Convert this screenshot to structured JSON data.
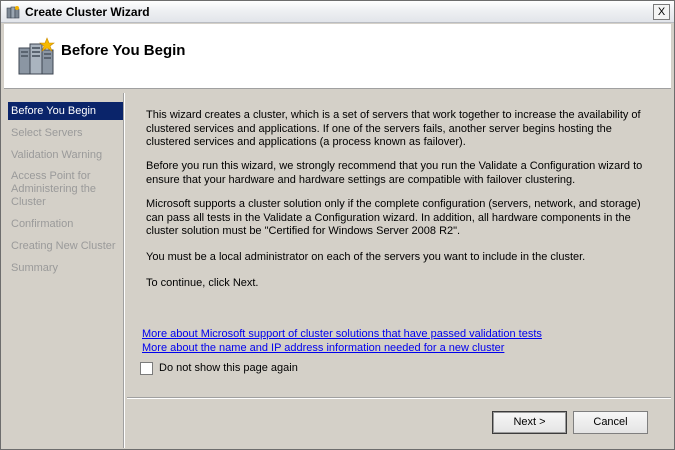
{
  "window": {
    "title": "Create Cluster Wizard",
    "close_glyph": "X"
  },
  "header": {
    "title": "Before You Begin",
    "icon": "cluster-servers-icon"
  },
  "sidebar": {
    "items": [
      {
        "label": "Before You Begin",
        "active": true
      },
      {
        "label": "Select Servers",
        "active": false
      },
      {
        "label": "Validation Warning",
        "active": false
      },
      {
        "label": "Access Point for Administering the Cluster",
        "active": false
      },
      {
        "label": "Confirmation",
        "active": false
      },
      {
        "label": "Creating New Cluster",
        "active": false
      },
      {
        "label": "Summary",
        "active": false
      }
    ]
  },
  "content": {
    "paragraphs": [
      "This wizard creates a cluster, which is a set of servers that work together to increase the availability of clustered services and applications. If one of the servers fails, another server begins hosting the clustered services and applications (a process known as failover).",
      "Before you run this wizard, we strongly recommend that you run the Validate a Configuration wizard to ensure that your hardware and hardware settings are compatible with failover clustering.",
      "Microsoft supports a cluster solution only if the complete configuration (servers, network, and storage) can pass all tests in the Validate a Configuration wizard.  In addition, all hardware components in the cluster solution must be \"Certified for Windows Server 2008 R2\".",
      "You must be a local administrator on each of the servers you want to include in the cluster.",
      "To continue, click Next."
    ],
    "links": [
      "More about Microsoft support of cluster solutions that have passed validation tests",
      "More about the name and IP address information needed for a new cluster"
    ],
    "checkbox_label": "Do not show this page again",
    "checkbox_checked": false
  },
  "buttons": {
    "next": "Next >",
    "cancel": "Cancel"
  },
  "colors": {
    "selection": "#0a246a",
    "link": "#0000ee",
    "disabled_text": "#9a9a9a",
    "dialog_bg": "#d4d0c8"
  }
}
